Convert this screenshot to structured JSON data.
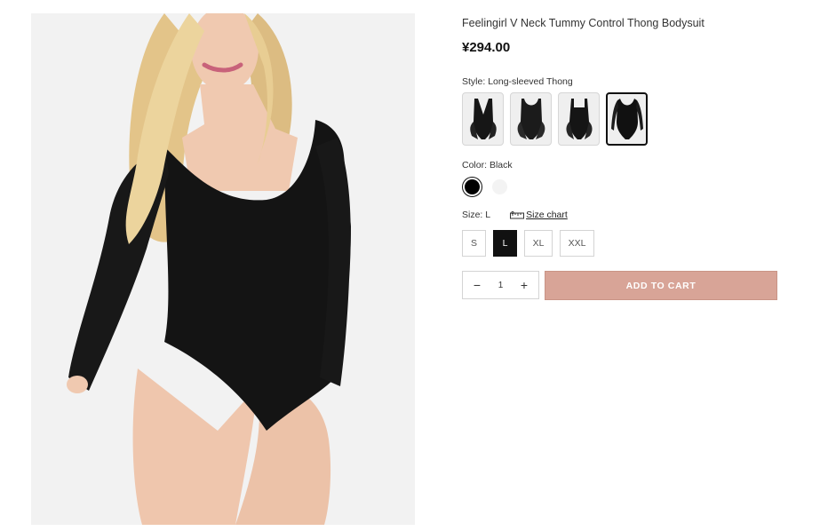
{
  "product": {
    "title": "Feelingirl V Neck Tummy Control Thong Bodysuit",
    "price": "¥294.00",
    "image_alt": "model wearing black long-sleeved thong bodysuit"
  },
  "style": {
    "label": "Style:",
    "selected": "Long-sleeved Thong",
    "options": [
      {
        "name": "v-neck-thong"
      },
      {
        "name": "scoop-thong"
      },
      {
        "name": "square-neck-thong"
      },
      {
        "name": "long-sleeved-thong",
        "selected": true
      }
    ]
  },
  "color": {
    "label": "Color:",
    "selected": "Black",
    "options": [
      {
        "name": "Black",
        "hex": "#000000",
        "selected": true
      },
      {
        "name": "White",
        "hex": "#f3f3f3"
      }
    ]
  },
  "size": {
    "label": "Size:",
    "selected": "L",
    "size_chart_label": "Size chart",
    "options": [
      "S",
      "L",
      "XL",
      "XXL"
    ]
  },
  "cart": {
    "quantity": "1",
    "minus": "−",
    "plus": "+",
    "add_label": "ADD TO CART"
  },
  "colors": {
    "accent": "#d8a497",
    "selected_bg": "#111111"
  }
}
